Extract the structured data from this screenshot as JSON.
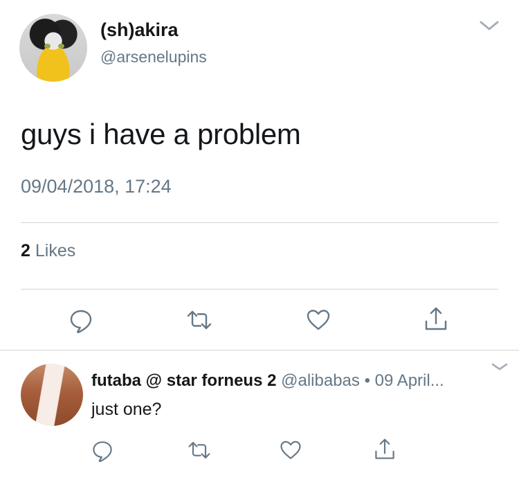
{
  "tweet": {
    "display_name": "(sh)akira",
    "handle": "@arsenelupins",
    "text": "guys i have a problem",
    "timestamp": "09/04/2018, 17:24",
    "likes_count": "2",
    "likes_label": "Likes",
    "avatar_icon": "cat-avatar-icon"
  },
  "reply": {
    "display_name": "futaba @ star forneus 2",
    "meta": "@alibabas • 09 April...",
    "text": "just one?",
    "avatar_icon": "user-avatar-icon"
  },
  "actions": [
    "reply-icon",
    "retweet-icon",
    "like-icon",
    "share-icon"
  ],
  "colors": {
    "text_primary": "#14171a",
    "text_secondary": "#657786",
    "divider": "#d0d6db"
  }
}
